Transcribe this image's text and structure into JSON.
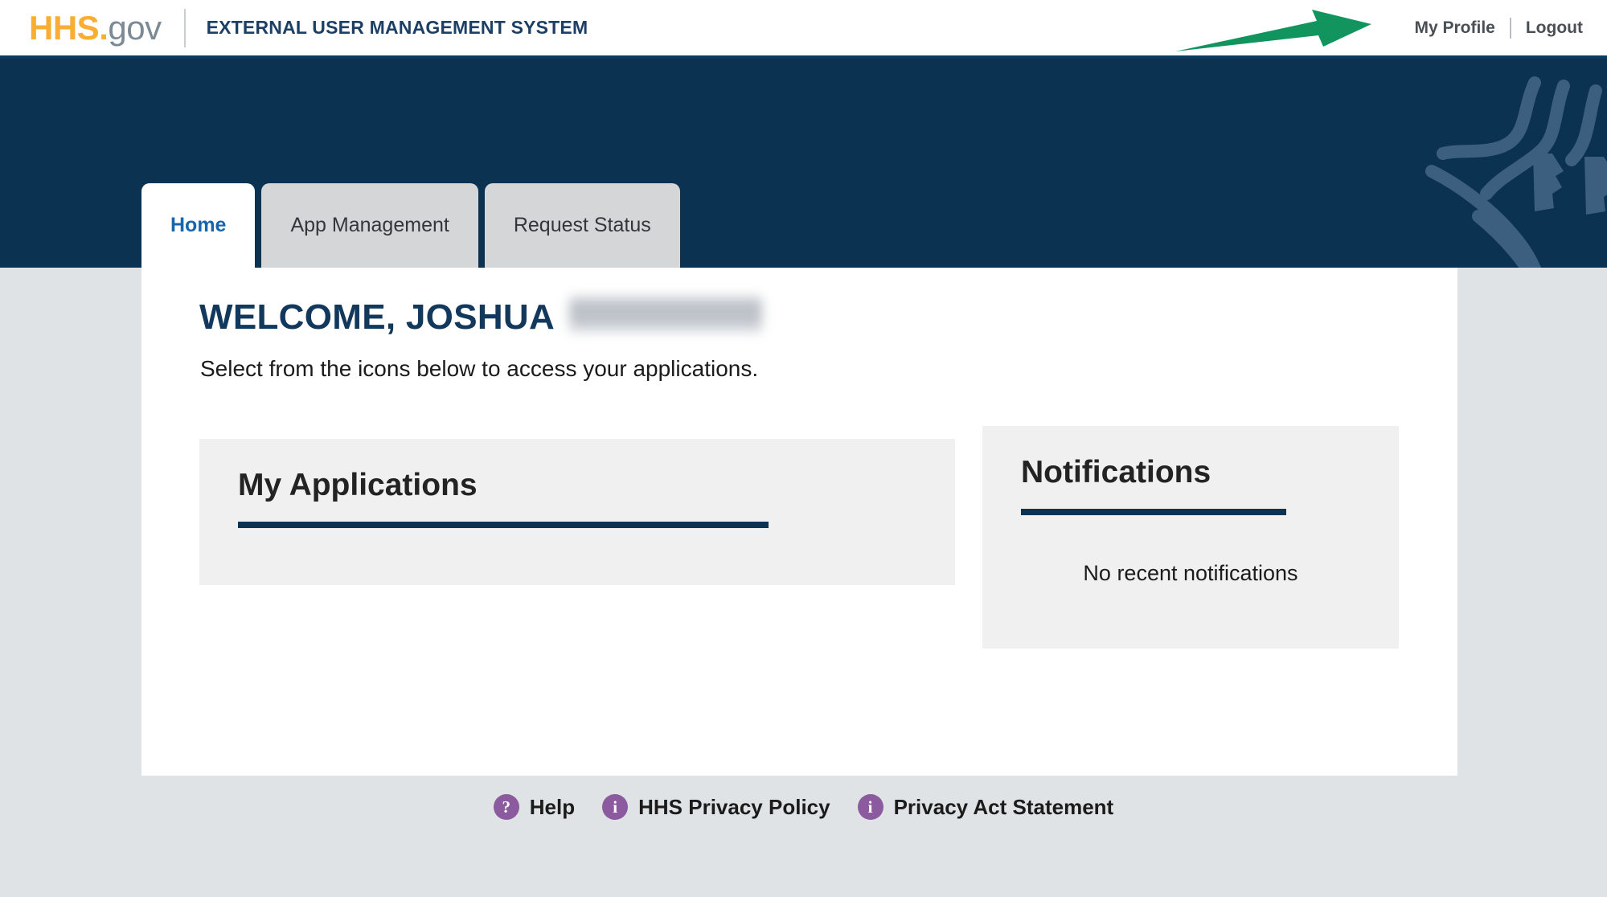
{
  "header": {
    "logo_primary": "HHS",
    "logo_dot": ".",
    "logo_secondary": "gov",
    "system_title": "EXTERNAL USER MANAGEMENT SYSTEM",
    "my_profile_label": "My Profile",
    "logout_label": "Logout"
  },
  "annotation": {
    "arrow_color": "#12945f",
    "points_to": "My Profile"
  },
  "tabs": [
    {
      "label": "Home",
      "active": true
    },
    {
      "label": "App Management",
      "active": false
    },
    {
      "label": "Request Status",
      "active": false
    }
  ],
  "main": {
    "welcome_heading": "WELCOME, JOSHUA",
    "welcome_name_redacted": true,
    "welcome_subtitle": "Select from the icons below to access your applications.",
    "panels": {
      "applications": {
        "title": "My Applications",
        "items": []
      },
      "notifications": {
        "title": "Notifications",
        "empty_message": "No recent notifications"
      }
    }
  },
  "footer": {
    "links": [
      {
        "icon": "question-mark-icon",
        "glyph": "?",
        "label": "Help"
      },
      {
        "icon": "info-icon",
        "glyph": "i",
        "label": "HHS Privacy Policy"
      },
      {
        "icon": "info-icon",
        "glyph": "i",
        "label": "Privacy Act Statement"
      }
    ]
  },
  "colors": {
    "navy": "#0b3250",
    "header_border": "#0b3d60",
    "gold": "#f9ae33",
    "gov_gray": "#7c8a96",
    "active_tab_text": "#1665ad",
    "page_background": "#dfe3e6",
    "panel_background": "#f0f0f0",
    "footer_icon": "#8b5a9f",
    "annotation_green": "#12945f"
  }
}
